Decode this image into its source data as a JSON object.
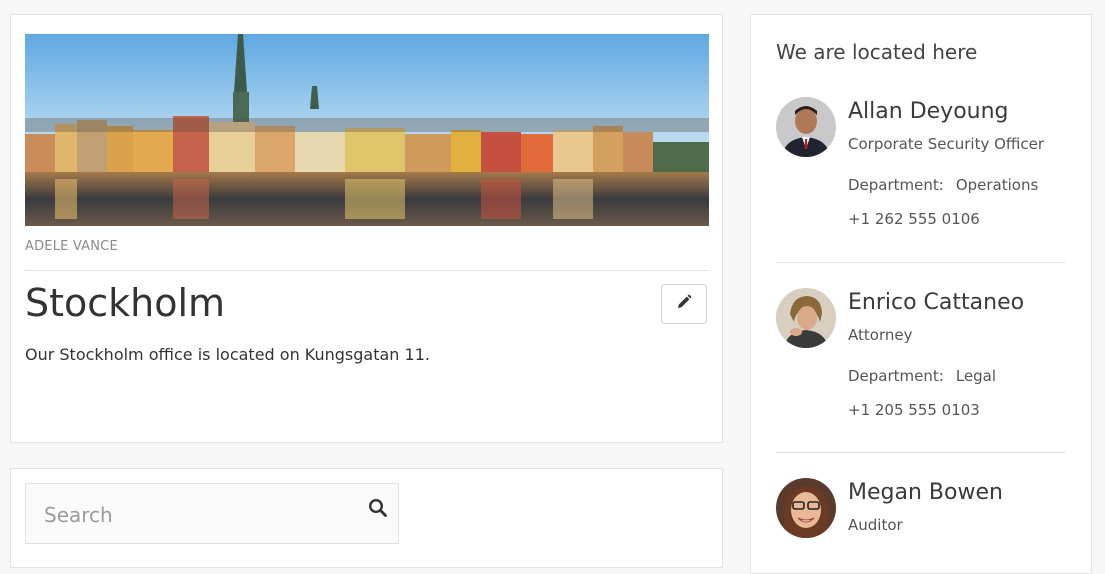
{
  "article": {
    "author": "ADELE VANCE",
    "title": "Stockholm",
    "description": "Our Stockholm office is located on Kungsgatan 11.",
    "hero_image": "stockholm-skyline-photo",
    "edit_icon": "pencil-icon"
  },
  "search": {
    "placeholder": "Search",
    "value": "",
    "icon": "search-icon"
  },
  "location": {
    "heading": "We are located here",
    "people": [
      {
        "name": "Allan Deyoung",
        "title": "Corporate Security Officer",
        "department_label": "Department:",
        "department": "Operations",
        "phone": "+1 262 555 0106"
      },
      {
        "name": "Enrico Cattaneo",
        "title": "Attorney",
        "department_label": "Department:",
        "department": "Legal",
        "phone": "+1 205 555 0103"
      },
      {
        "name": "Megan Bowen",
        "title": "Auditor"
      }
    ]
  },
  "colors": {
    "page_background": "#f7f7f7",
    "card_border": "#e3e3e3",
    "text": "#333333",
    "muted": "#8a8a8a"
  }
}
